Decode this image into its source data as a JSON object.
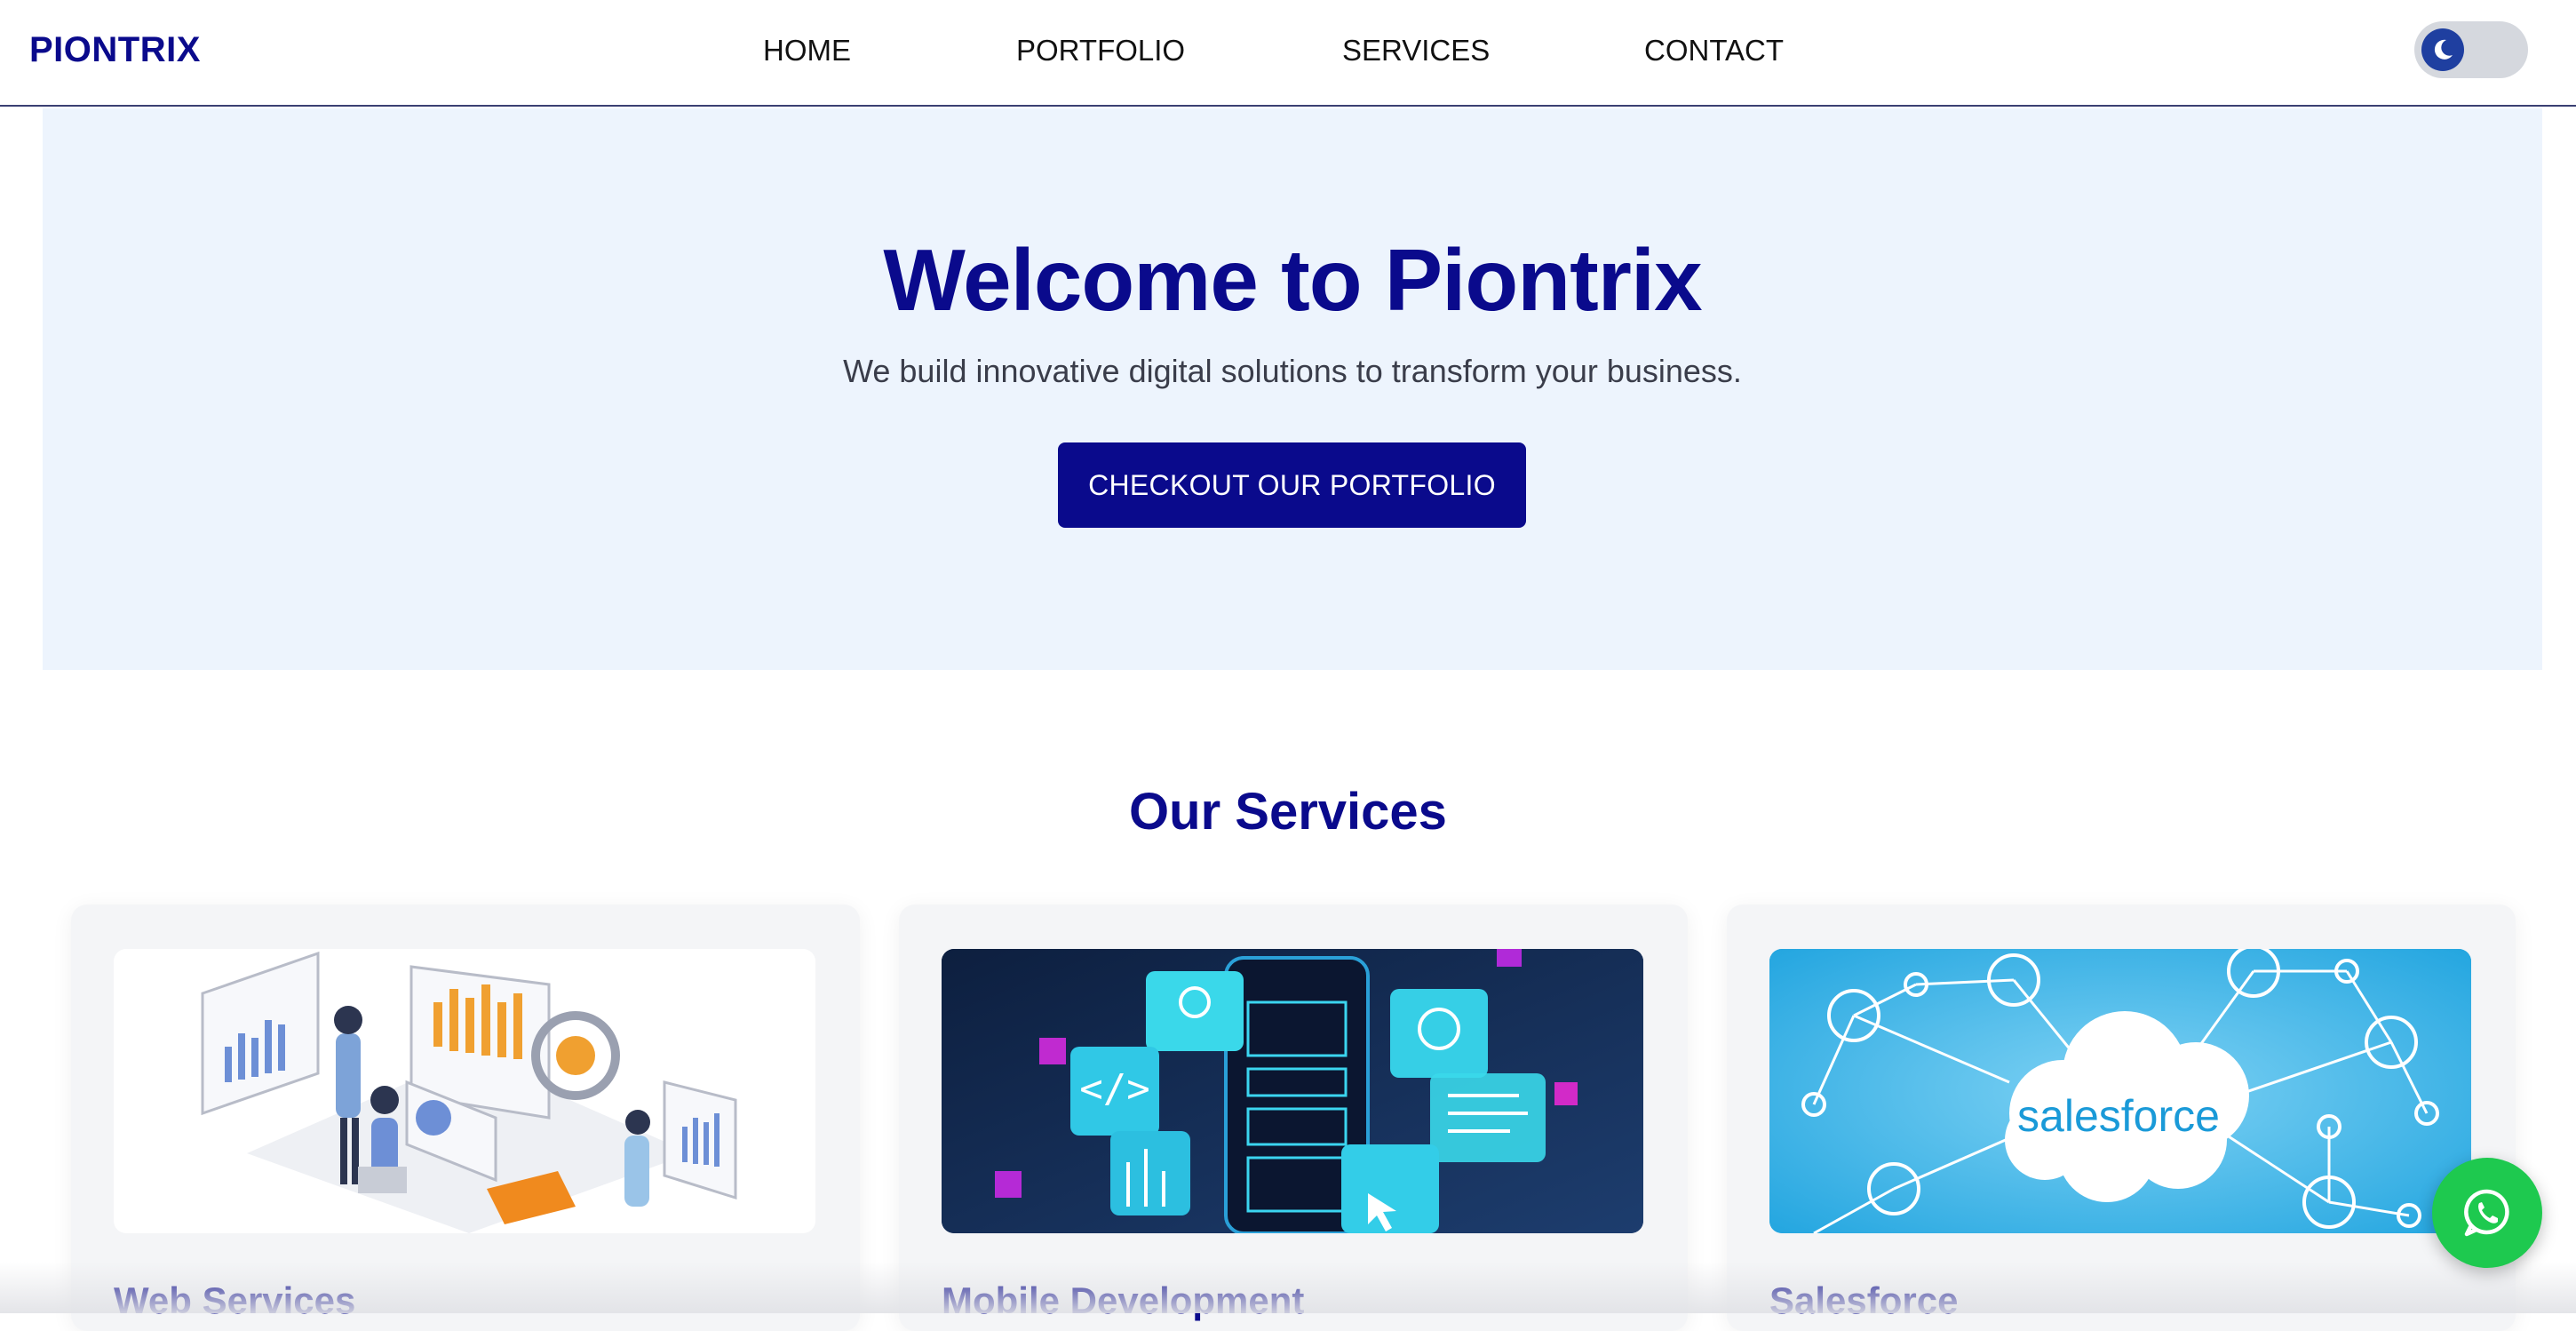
{
  "brand": {
    "logo_text": "PIONTRIX"
  },
  "nav": {
    "links": [
      {
        "label": "HOME"
      },
      {
        "label": "PORTFOLIO"
      },
      {
        "label": "SERVICES"
      },
      {
        "label": "CONTACT"
      }
    ],
    "theme_toggle_icon": "moon-icon"
  },
  "hero": {
    "title": "Welcome to Piontrix",
    "subtitle": "We build innovative digital solutions to transform your business.",
    "cta_label": "CHECKOUT OUR PORTFOLIO"
  },
  "services": {
    "title": "Our Services",
    "cards": [
      {
        "title": "Web Services",
        "image": "isometric-analytics-illustration"
      },
      {
        "title": "Mobile Development",
        "image": "mobile-app-ui-illustration"
      },
      {
        "title": "Salesforce",
        "image": "salesforce-cloud-network",
        "image_text": "salesforce"
      }
    ]
  },
  "floating": {
    "icon": "whatsapp-icon"
  },
  "colors": {
    "brand_navy": "#0a0a8c",
    "hero_bg": "#edf4fd",
    "card_bg": "#f4f5f7",
    "whatsapp_green": "#1ec94f",
    "toggle_bg": "#d5d8de",
    "toggle_knob": "#1f3fa0"
  }
}
